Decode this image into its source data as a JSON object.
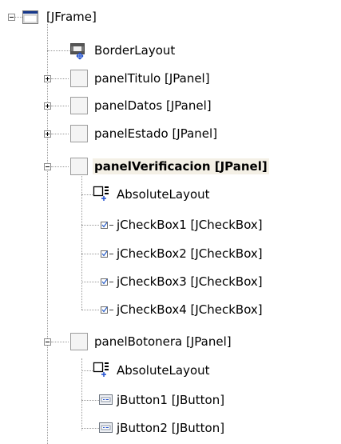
{
  "tree": {
    "root": {
      "label": "[JFrame]",
      "icon": "frame-icon"
    },
    "nodes": [
      {
        "label": "BorderLayout",
        "icon": "border-layout-icon"
      },
      {
        "label": "panelTitulo [JPanel]",
        "icon": "panel-icon",
        "state": "collapsed"
      },
      {
        "label": "panelDatos [JPanel]",
        "icon": "panel-icon",
        "state": "collapsed"
      },
      {
        "label": "panelEstado [JPanel]",
        "icon": "panel-icon",
        "state": "collapsed"
      },
      {
        "label": "panelVerificacion [JPanel]",
        "icon": "panel-icon",
        "state": "expanded",
        "selected": true,
        "children": [
          {
            "label": "AbsoluteLayout",
            "icon": "absolute-layout-icon"
          },
          {
            "label": "jCheckBox1 [JCheckBox]",
            "icon": "checkbox-icon"
          },
          {
            "label": "jCheckBox2 [JCheckBox]",
            "icon": "checkbox-icon"
          },
          {
            "label": "jCheckBox3 [JCheckBox]",
            "icon": "checkbox-icon"
          },
          {
            "label": "jCheckBox4 [JCheckBox]",
            "icon": "checkbox-icon"
          }
        ]
      },
      {
        "label": "panelBotonera [JPanel]",
        "icon": "panel-icon",
        "state": "expanded",
        "children": [
          {
            "label": "AbsoluteLayout",
            "icon": "absolute-layout-icon"
          },
          {
            "label": "jButton1 [JButton]",
            "icon": "button-icon"
          },
          {
            "label": "jButton2 [JButton]",
            "icon": "button-icon"
          }
        ]
      }
    ]
  }
}
